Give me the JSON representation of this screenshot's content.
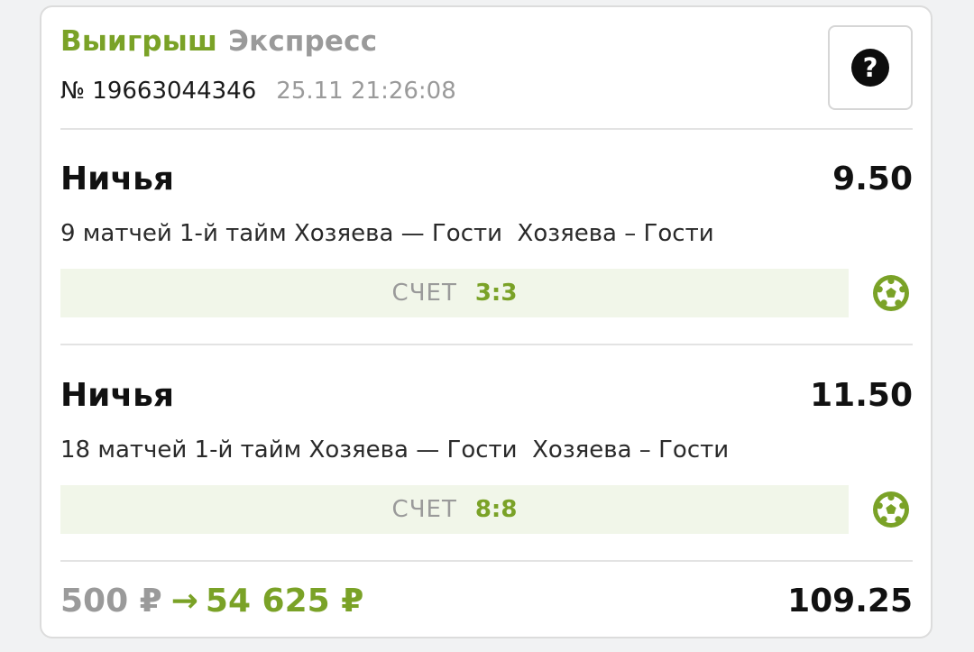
{
  "header": {
    "status": "Выигрыш",
    "bet_type": "Экспресс",
    "ticket_number": "№ 19663044346",
    "datetime": "25.11 21:26:08",
    "help_icon": "question-circle-icon",
    "help_symbol": "?"
  },
  "bets": [
    {
      "outcome": "Ничья",
      "odds": "9.50",
      "description": "9 матчей 1-й тайм Хозяева — Гости  Хозяева – Гости",
      "score_label": "СЧЕТ",
      "score_value": "3:3",
      "sport_icon": "soccer-ball-icon"
    },
    {
      "outcome": "Ничья",
      "odds": "11.50",
      "description": "18 матчей 1-й тайм Хозяева — Гости  Хозяева – Гости",
      "score_label": "СЧЕТ",
      "score_value": "8:8",
      "sport_icon": "soccer-ball-icon"
    }
  ],
  "footer": {
    "stake": "500 ₽",
    "arrow": "→",
    "payout": "54 625 ₽",
    "total_odds": "109.25"
  },
  "colors": {
    "accent_green": "#7aa227",
    "muted_gray": "#9a9a9a",
    "score_bg": "#f1f6e9"
  }
}
